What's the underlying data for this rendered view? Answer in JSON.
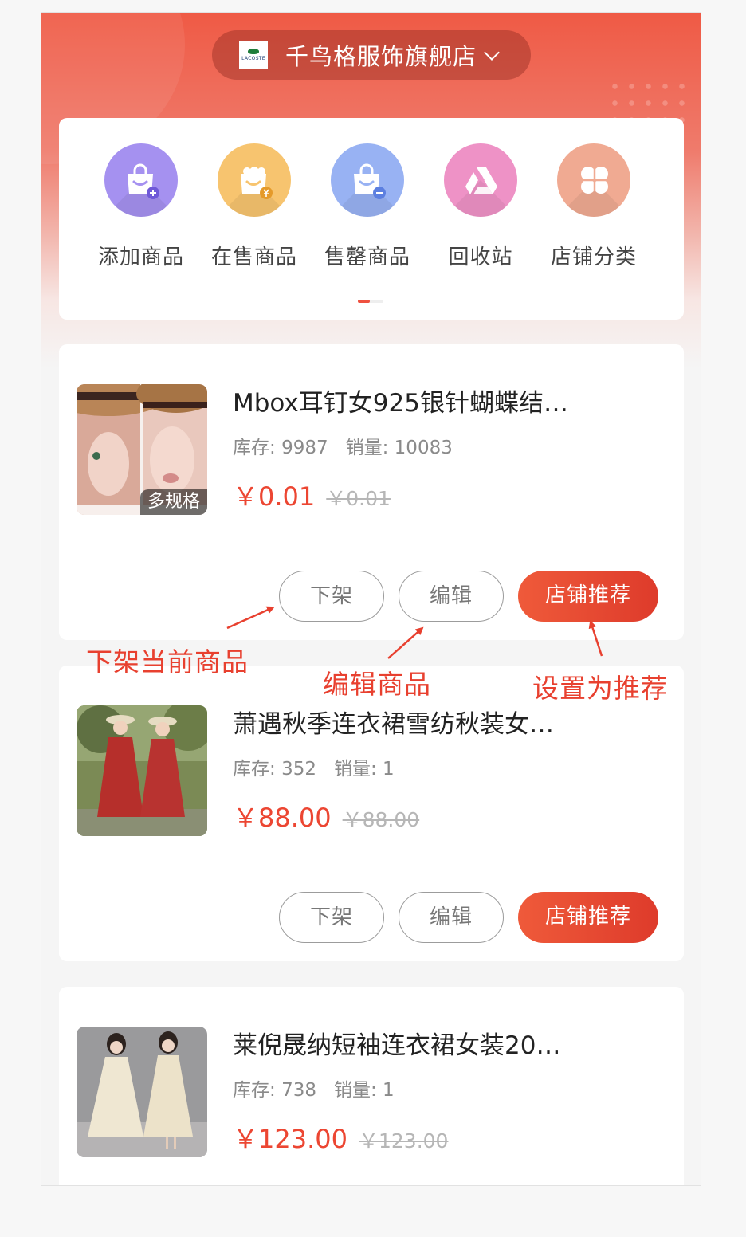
{
  "header": {
    "store_logo_text": "LACOSTE",
    "store_name": "千鸟格服饰旗舰店"
  },
  "menu": {
    "items": [
      {
        "label": "添加商品",
        "icon": "bag-add-icon",
        "color": "#a591f0"
      },
      {
        "label": "在售商品",
        "icon": "bag-yen-icon",
        "color": "#f7c46f"
      },
      {
        "label": "售罄商品",
        "icon": "bag-minus-icon",
        "color": "#98b2f3"
      },
      {
        "label": "回收站",
        "icon": "recycle-triangle-icon",
        "color": "#ee92c6"
      },
      {
        "label": "店铺分类",
        "icon": "clover-category-icon",
        "color": "#f0aa92"
      }
    ],
    "active_page": 1,
    "page_count": 2
  },
  "products": [
    {
      "title": "Mbox耳钉女925银针蝴蝶结…",
      "stock_label": "库存: ",
      "stock": "9987",
      "sales_label": "销量: ",
      "sales": "10083",
      "price": "￥0.01",
      "original_price": "￥0.01",
      "badge": "多规格",
      "delist_label": "下架",
      "edit_label": "编辑",
      "recommend_label": "店铺推荐"
    },
    {
      "title": "萧遇秋季连衣裙雪纺秋装女…",
      "stock_label": "库存: ",
      "stock": "352",
      "sales_label": "销量: ",
      "sales": "1",
      "price": "￥88.00",
      "original_price": "￥88.00",
      "delist_label": "下架",
      "edit_label": "编辑",
      "recommend_label": "店铺推荐"
    },
    {
      "title": "莱倪晟纳短袖连衣裙女装20…",
      "stock_label": "库存: ",
      "stock": "738",
      "sales_label": "销量: ",
      "sales": "1",
      "price": "￥123.00",
      "original_price": "￥123.00"
    }
  ],
  "annotations": {
    "delist": "下架当前商品",
    "edit": "编辑商品",
    "recommend": "设置为推荐"
  },
  "colors": {
    "brand_red": "#ef5140",
    "price_red": "#ec4632",
    "annotation_red": "#e8402f"
  }
}
